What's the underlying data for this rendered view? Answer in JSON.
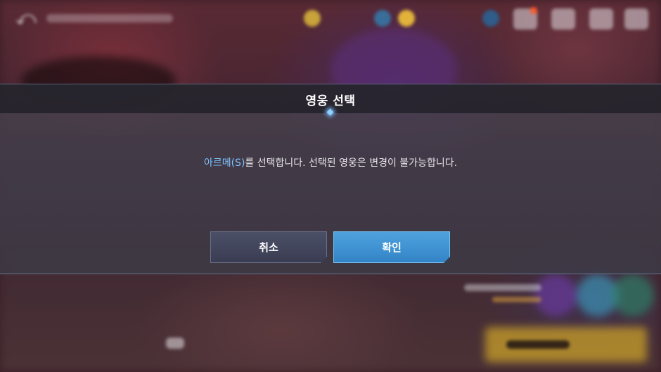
{
  "dialog": {
    "title": "영웅 선택",
    "message_highlight": "아르메(S)",
    "message_rest": "를 선택합니다. 선택된 영웅은 변경이 불가능합니다.",
    "cancel_label": "취소",
    "confirm_label": "확인"
  },
  "hud": {
    "back_icon": "back-arrow-icon",
    "top_buttons": [
      "currency-icon",
      "currency-icon",
      "menu-button",
      "menu-button",
      "menu-button",
      "menu-button"
    ]
  },
  "colors": {
    "highlight": "#7ec1ff",
    "confirm_button": "#3f93d2",
    "cancel_button": "#43465c",
    "accent_diamond": "#8fd0ff"
  }
}
